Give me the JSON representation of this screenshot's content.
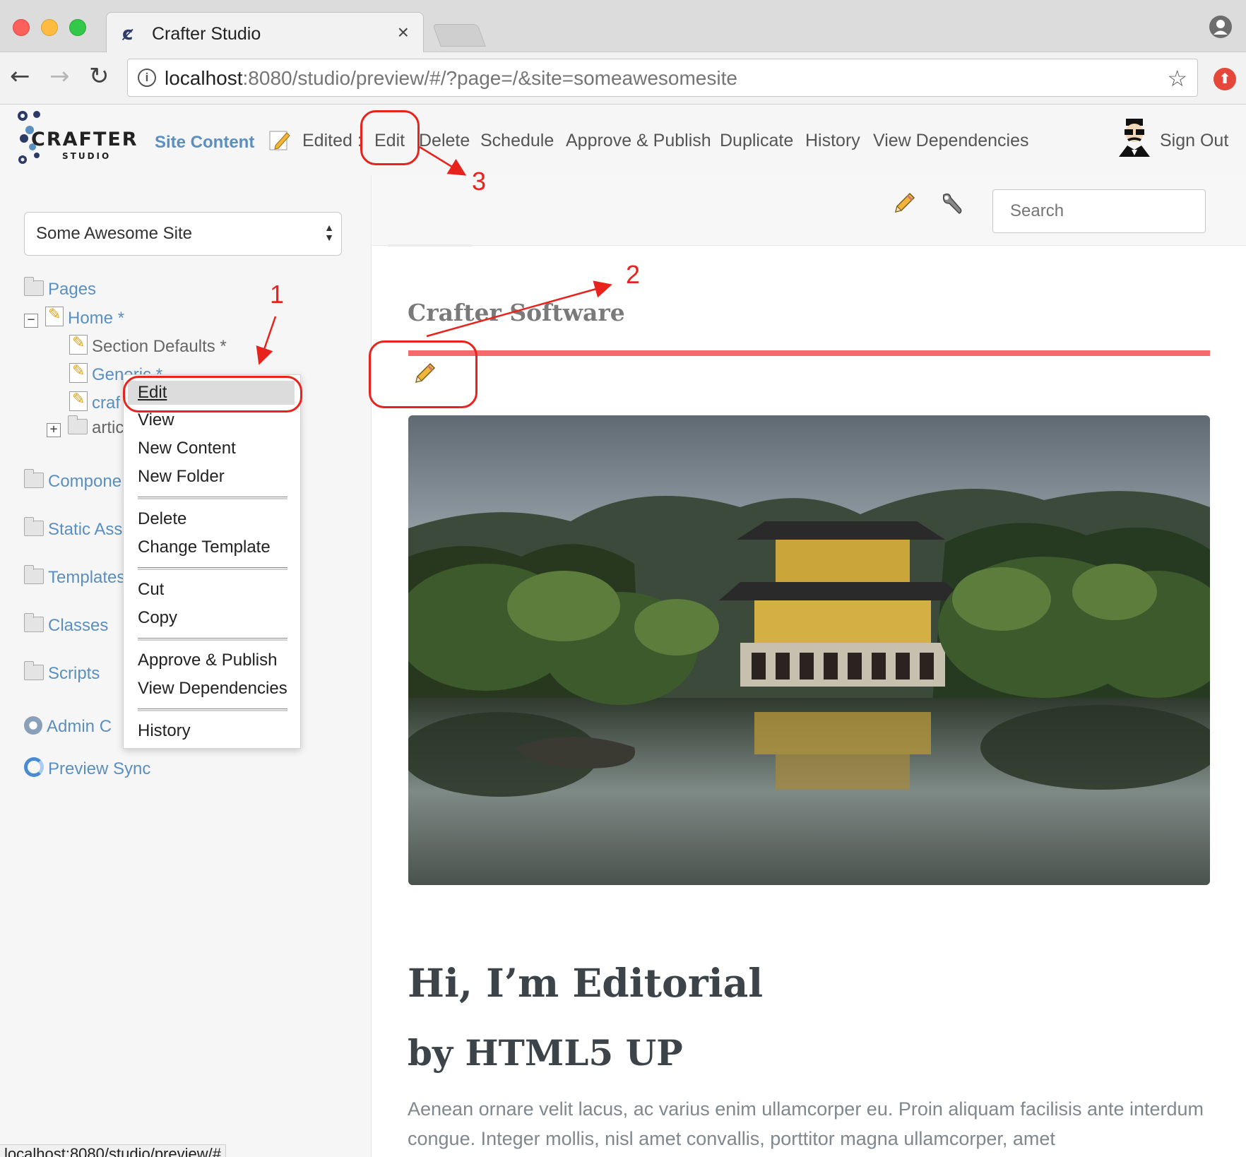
{
  "browser": {
    "tab_title": "Crafter Studio",
    "tab_close": "×",
    "url_host": "localhost",
    "url_rest": ":8080/studio/preview/#/?page=/&site=someawesomesite",
    "status_url": "localhost:8080/studio/preview/#"
  },
  "header": {
    "logo_word": "CRAFTER",
    "logo_sub": "STUDIO",
    "site_content": "Site Content",
    "edited_label": "Edited :",
    "nav": [
      "Edit",
      "Delete",
      "Schedule",
      "Approve & Publish",
      "Duplicate",
      "History",
      "View Dependencies"
    ],
    "sign_out": "Sign Out"
  },
  "sidebar": {
    "site_selector": "Some Awesome Site",
    "tree": {
      "pages": "Pages",
      "home": "Home *",
      "section_defaults": "Section Defaults *",
      "generic": "Generic *",
      "crafter": "craf",
      "articles": "artic",
      "components": "Compone",
      "static_assets": "Static Ass",
      "templates": "Templates",
      "classes": "Classes",
      "scripts": "Scripts",
      "admin": "Admin C",
      "preview_sync": "Preview Sync"
    },
    "context_menu": {
      "edit": "Edit",
      "view": "View",
      "new_content": "New Content",
      "new_folder": "New Folder",
      "delete": "Delete",
      "change_template": "Change Template",
      "cut": "Cut",
      "copy": "Copy",
      "approve_publish": "Approve & Publish",
      "view_dependencies": "View Dependencies",
      "history": "History"
    }
  },
  "preview": {
    "search_placeholder": "Search",
    "site_title": "Crafter Software",
    "heading": "Hi, I’m Editorial",
    "subheading": "by HTML5 UP",
    "paragraph": "Aenean ornare velit lacus, ac varius enim ullamcorper eu. Proin aliquam facilisis ante interdum congue. Integer mollis, nisl amet convallis, porttitor magna ullamcorper, amet"
  },
  "annotations": {
    "callout_1": "1",
    "callout_2": "2",
    "callout_3": "3"
  },
  "colors": {
    "accent_blue": "#5a8fbf",
    "title_bar_red": "#f56a6a",
    "annotation_red": "#e8231e"
  }
}
